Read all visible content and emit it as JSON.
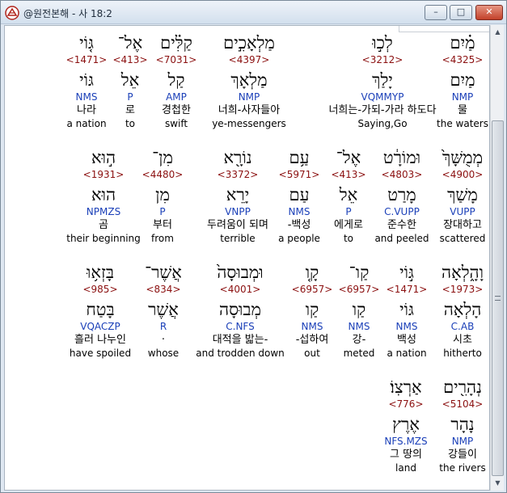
{
  "window": {
    "title": "@원전본해 - 사 18:2",
    "min_glyph": "–",
    "max_glyph": "□",
    "close_glyph": "✕"
  },
  "rows": [
    [
      {
        "word": "מַ֗יִם",
        "strong": "<4325>",
        "lemma": "מַיִם",
        "morph": "NMP",
        "kor": "물",
        "eng": "the waters"
      },
      {
        "word": "לְכ֣וּ",
        "strong": "<3212>",
        "lemma": "יָלַךְ",
        "morph": "VQMMYP",
        "kor": "너희는-가되-가라 하도다",
        "eng": "Saying,Go"
      },
      {
        "word": "מַלְאָכִ֣ים",
        "strong": "<4397>",
        "lemma": "מַלְאָךְ",
        "morph": "NMP",
        "kor": "너희-사자들아",
        "eng": "ye-messengers"
      },
      {
        "word": "קַלִּ֗ים",
        "strong": "<7031>",
        "lemma": "קַל",
        "morph": "AMP",
        "kor": "경첩한",
        "eng": "swift"
      },
      {
        "word": "אֶל־",
        "strong": "<413>",
        "lemma": "אֵל",
        "morph": "P",
        "kor": "로",
        "eng": "to"
      },
      {
        "word": "גּ֤וֹי",
        "strong": "<1471>",
        "lemma": "גּוֹי",
        "morph": "NMS",
        "kor": "나라",
        "eng": "a nation"
      }
    ],
    [
      {
        "word": "מְמֻשָּׁךְ֙",
        "strong": "<4900>",
        "lemma": "מָשַׁךְ",
        "morph": "VUPP",
        "kor": "장대하고",
        "eng": "scattered"
      },
      {
        "word": "וּמוֹרָ֔ט",
        "strong": "<4803>",
        "lemma": "מָרַט",
        "morph": "C.VUPP",
        "kor": "준수한",
        "eng": "and peeled"
      },
      {
        "word": "אֶל־",
        "strong": "<413>",
        "lemma": "אֵל",
        "morph": "P",
        "kor": "에게로",
        "eng": "to"
      },
      {
        "word": "עַ֥ם",
        "strong": "<5971>",
        "lemma": "עַם",
        "morph": "NMS",
        "kor": "-백성",
        "eng": "a people"
      },
      {
        "word": "נוֹרָ֖א",
        "strong": "<3372>",
        "lemma": "יָרֵא",
        "morph": "VNPP",
        "kor": "두려움이 되며",
        "eng": "terrible"
      },
      {
        "word": "מִן־",
        "strong": "<4480>",
        "lemma": "מִן",
        "morph": "P",
        "kor": "부터",
        "eng": "from"
      },
      {
        "word": "ה֣וּא",
        "strong": "<1931>",
        "lemma": "הוּא",
        "morph": "NPMZS",
        "kor": "곰",
        "eng": "their beginning"
      }
    ],
    [
      {
        "word": "וָהָ֑לְאָה",
        "strong": "<1973>",
        "lemma": "הָלְאָה",
        "morph": "C.AB",
        "kor": "시초",
        "eng": "hitherto"
      },
      {
        "word": "גּ֣וֹי",
        "strong": "<1471>",
        "lemma": "גּוֹי",
        "morph": "NMS",
        "kor": "백성",
        "eng": "a nation"
      },
      {
        "word": "קַו־",
        "strong": "<6957>",
        "lemma": "קַו",
        "morph": "NMS",
        "kor": "강-",
        "eng": "meted"
      },
      {
        "word": "קָ֤ו",
        "strong": "<6957>",
        "lemma": "קַו",
        "morph": "NMS",
        "kor": "-섭하여",
        "eng": "out"
      },
      {
        "word": "וּמְבוּסָה֙",
        "strong": "<4001>",
        "lemma": "מְבוּסָה",
        "morph": "C.NFS",
        "kor": "대적을 밟는-",
        "eng": "and trodden down"
      },
      {
        "word": "אֲשֶׁר־",
        "strong": "<834>",
        "lemma": "אֲשֶׁר",
        "morph": "R",
        "kor": "·",
        "eng": "whose"
      },
      {
        "word": "בָּזְא֥וּ",
        "strong": "<985>",
        "lemma": "בָּטַח",
        "morph": "VQACZP",
        "kor": "흘러 나누인",
        "eng": "have spoiled"
      }
    ],
    [
      {
        "word": "נְהָרִ֖ים",
        "strong": "<5104>",
        "lemma": "נָהָר",
        "morph": "NMP",
        "kor": "강들이",
        "eng": "the rivers"
      },
      {
        "word": "אַרְצֽוֹ׃",
        "strong": "<776>",
        "lemma": "אֶרֶץ",
        "morph": "NFS.MZS",
        "kor": "그 땅의",
        "eng": "land"
      }
    ]
  ]
}
